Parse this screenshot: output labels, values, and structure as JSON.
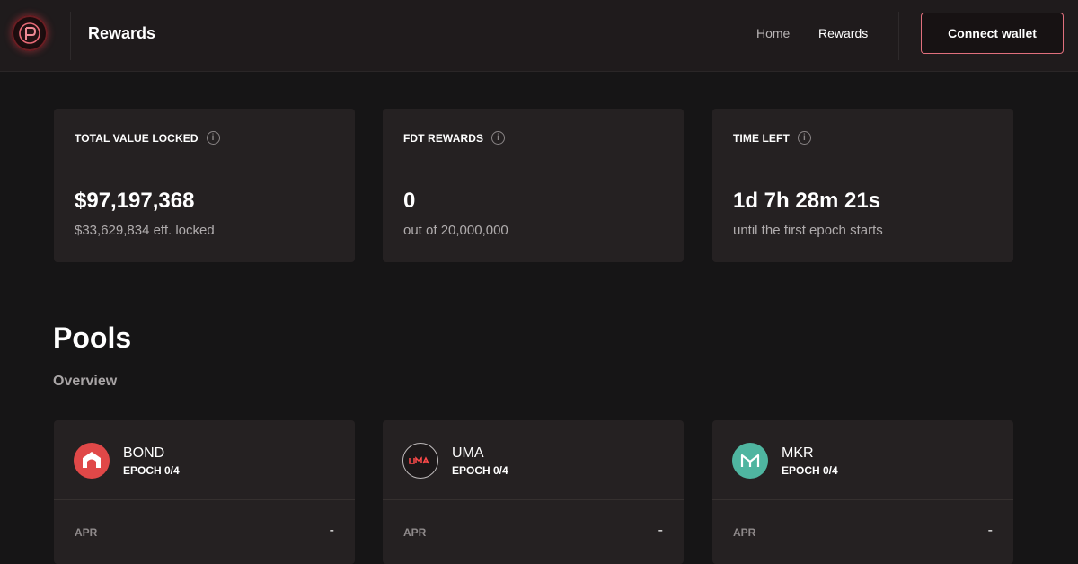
{
  "header": {
    "title": "Rewards",
    "nav": {
      "home": "Home",
      "rewards": "Rewards"
    },
    "connect_label": "Connect wallet",
    "logo_icon": "fiat-dao-logo-icon",
    "accent_color": "#e06f7c"
  },
  "stats": [
    {
      "label": "TOTAL VALUE LOCKED",
      "value": "$97,197,368",
      "sub": "$33,629,834 eff. locked",
      "info": "i"
    },
    {
      "label": "FDT REWARDS",
      "value": "0",
      "sub": "out of 20,000,000",
      "info": "i"
    },
    {
      "label": "TIME LEFT",
      "value": "1d 7h 28m 21s",
      "sub": "until the first epoch starts",
      "info": "i"
    }
  ],
  "pools": {
    "title": "Pools",
    "subtitle": "Overview",
    "items": [
      {
        "name": "BOND",
        "epoch": "EPOCH 0/4",
        "apr_label": "APR",
        "apr_value": "-",
        "icon": "bond-token-icon",
        "color": "#e04848"
      },
      {
        "name": "UMA",
        "epoch": "EPOCH 0/4",
        "apr_label": "APR",
        "apr_value": "-",
        "icon": "uma-token-icon",
        "color": "#ff4a4a"
      },
      {
        "name": "MKR",
        "epoch": "EPOCH 0/4",
        "apr_label": "APR",
        "apr_value": "-",
        "icon": "mkr-token-icon",
        "color": "#4fb5a0"
      }
    ]
  }
}
